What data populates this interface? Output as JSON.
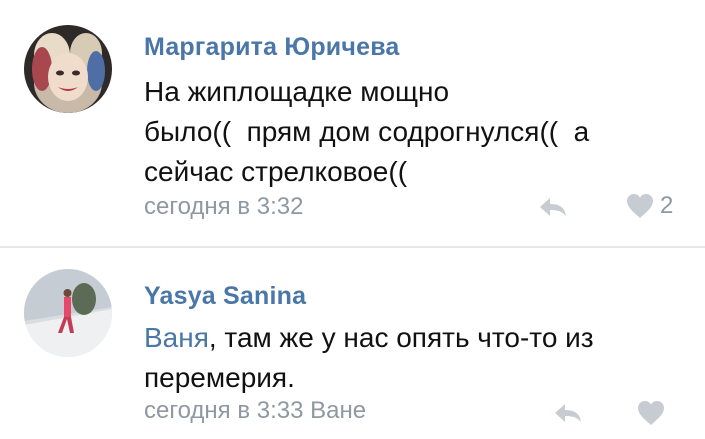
{
  "comments": [
    {
      "author": "Маргарита Юричева",
      "text_lines": [
        "На жиплощадке мощно",
        "было((  прям дом содрогнулся((  а",
        "сейчас стрелковое(("
      ],
      "time": "сегодня в 3:32",
      "likes": "2"
    },
    {
      "author": "Yasya Sanina",
      "mention": "Ваня",
      "text_after_mention": ", там же у нас опять что-то из",
      "text_line2": "перемерия.",
      "time": "сегодня в 3:33 Ване",
      "likes": ""
    }
  ],
  "colors": {
    "link": "#4a76a8",
    "meta": "#8f98a2",
    "text": "#111111",
    "divider": "#e6e8eb"
  },
  "icons": [
    "reply-icon",
    "heart-icon"
  ]
}
